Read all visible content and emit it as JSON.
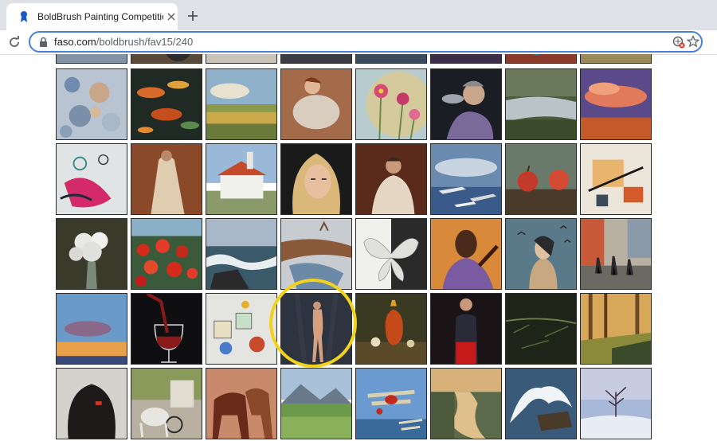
{
  "browser": {
    "tab_title": "BoldBrush Painting Competitio",
    "url_host": "faso.com",
    "url_path": "/boldbrush/fav15/240"
  },
  "gallery": {
    "rows": [
      [
        "top-partial-1",
        "top-partial-2",
        "top-partial-3",
        "top-partial-4",
        "top-partial-5",
        "top-partial-6",
        "top-partial-7",
        "top-partial-8"
      ],
      [
        "abstract-pattern",
        "lily-pads",
        "landscape-field",
        "reclining-woman",
        "pink-cosmos-flowers",
        "man-smoking",
        "misty-pond",
        "purple-sunset-sky"
      ],
      [
        "abstract-pink",
        "figure-in-robe",
        "white-church",
        "blonde-portrait",
        "seated-woman",
        "jets-in-flight",
        "two-apples",
        "abstract-collage"
      ],
      [
        "white-flowers-vase",
        "red-poppies",
        "ocean-waves",
        "snowy-stream",
        "white-butterfly",
        "african-woman",
        "woman-with-birds",
        "city-street"
      ],
      [
        "dusk-clouds",
        "wine-glass-pour",
        "toy-blocks",
        "nude-figure",
        "still-life-vase",
        "woman-in-red",
        "dark-forest",
        "sunlit-trees"
      ],
      [
        "woman-back-hair",
        "horse-carriage",
        "two-horses",
        "green-valley",
        "biplanes",
        "river-sunset",
        "crashing-wave",
        "winter-tree"
      ]
    ],
    "highlighted": "nude-figure",
    "highlight_color": "#f2d21a"
  }
}
